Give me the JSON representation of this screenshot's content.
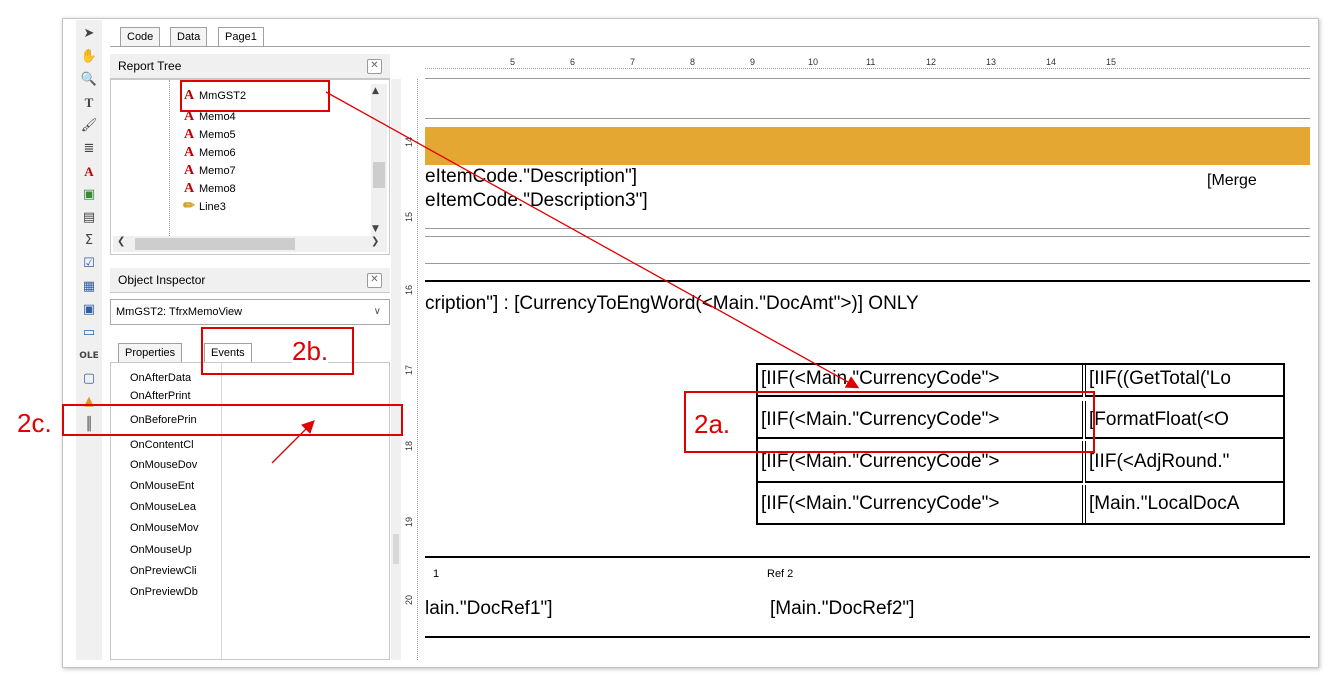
{
  "tabs": [
    "Code",
    "Data",
    "Page1"
  ],
  "report_tree": {
    "title": "Report Tree",
    "items": [
      "MmGST2",
      "Memo4",
      "Memo5",
      "Memo6",
      "Memo7",
      "Memo8",
      "Line3"
    ]
  },
  "object_inspector": {
    "title": "Object Inspector",
    "selected_object": "MmGST2: TfrxMemoView",
    "tabs": [
      "Properties",
      "Events"
    ],
    "events": [
      "OnAfterData",
      "OnAfterPrint",
      "OnBeforePrin",
      "OnContentCl",
      "OnMouseDov",
      "OnMouseEnt",
      "OnMouseLea",
      "OnMouseMov",
      "OnMouseUp",
      "OnPreviewCli",
      "OnPreviewDb"
    ]
  },
  "ruler": {
    "h_numbers": [
      "5",
      "6",
      "7",
      "8",
      "9",
      "10",
      "11",
      "12",
      "13",
      "14",
      "15"
    ],
    "v_numbers": [
      "14",
      "15",
      "16",
      "17",
      "18",
      "19",
      "20"
    ]
  },
  "designer": {
    "desc1": "eItemCode.\"Description\"]",
    "desc2": "eItemCode.\"Description3\"]",
    "merge": "[Merge",
    "words_line": "cription\"] : [CurrencyToEngWord(<Main.\"DocAmt\">)] ONLY",
    "grid": [
      [
        "[IIF(<Main.\"CurrencyCode\">",
        "[IIF((GetTotal('Lo"
      ],
      [
        "[IIF(<Main.\"CurrencyCode\">",
        "[FormatFloat(<O"
      ],
      [
        "[IIF(<Main.\"CurrencyCode\">",
        "[IIF(<AdjRound.\""
      ],
      [
        "[IIF(<Main.\"CurrencyCode\">",
        "[Main.\"LocalDocA"
      ]
    ],
    "ref1_label": "1",
    "ref1_value": "lain.\"DocRef1\"]",
    "ref2_label": "Ref 2",
    "ref2_value": "[Main.\"DocRef2\"]"
  },
  "annotations": {
    "a": "2a.",
    "b": "2b.",
    "c": "2c."
  },
  "colors": {
    "band": "#e3a732",
    "annotation": "#e00000",
    "accent_icon": "#c00000"
  }
}
